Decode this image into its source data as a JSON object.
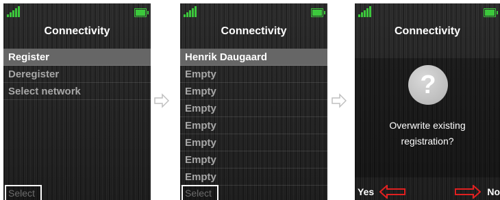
{
  "screens": [
    {
      "title": "Connectivity",
      "menu": [
        "Register",
        "Deregister",
        "Select network"
      ],
      "selected_index": 0,
      "softkey": "Select"
    },
    {
      "title": "Connectivity",
      "menu": [
        "Henrik Daugaard",
        "Empty",
        "Empty",
        "Empty",
        "Empty",
        "Empty",
        "Empty",
        "Empty"
      ],
      "selected_index": 0,
      "softkey": "Select"
    },
    {
      "title": "Connectivity",
      "icon": "question-icon",
      "icon_glyph": "?",
      "message_line1": "Overwrite existing",
      "message_line2": "registration?",
      "left_softkey": "Yes",
      "right_softkey": "No"
    }
  ],
  "colors": {
    "status_green": "#3cc83c",
    "arrow_red": "#e02020",
    "arrow_gray": "#bfbfbf"
  }
}
